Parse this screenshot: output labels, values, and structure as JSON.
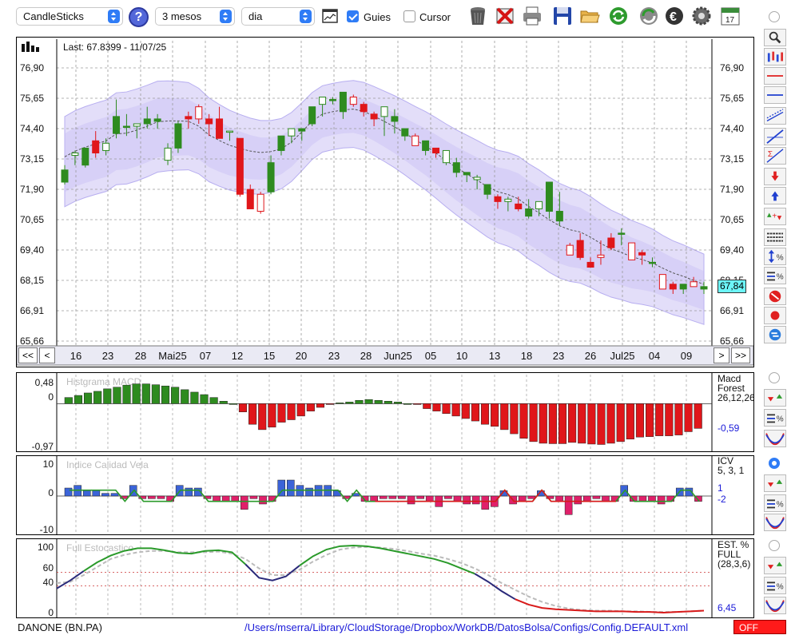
{
  "toolbar": {
    "chart_type": "CandleSticks",
    "help": "?",
    "period": "3 mesos",
    "interval": "dia",
    "guides_label": "Guies",
    "cursor_label": "Cursor"
  },
  "main": {
    "last_label": "Last: 67.8399 - 11/07/25",
    "price_tag": "67,84",
    "nav": {
      "first": "<<",
      "prev": "<",
      "next": ">",
      "last": ">>"
    }
  },
  "status": {
    "symbol": "DANONE (BN.PA)",
    "path": "/Users/mserra/Library/CloudStorage/Dropbox/WorkDB/DatosBolsa/Configs/Config.DEFAULT.xml",
    "off_label": "OFF"
  },
  "colors": {
    "up": "#2e8b1f",
    "down": "#e0161a",
    "band": "#d9d3f7",
    "icv_up": "#3b63d8",
    "icv_down": "#e0206a"
  },
  "chart_data": [
    {
      "type": "candlestick",
      "y_ticks": [
        "76,90",
        "75,65",
        "74,40",
        "73,15",
        "71,90",
        "70,65",
        "69,40",
        "68,15",
        "66,91",
        "65,66"
      ],
      "ylim": [
        65.66,
        76.9
      ],
      "x_labels": [
        "16",
        "23",
        "28",
        "Mai25",
        "07",
        "12",
        "15",
        "20",
        "23",
        "28",
        "Jun25",
        "05",
        "10",
        "13",
        "18",
        "23",
        "26",
        "Jul25",
        "04",
        "09"
      ],
      "candles": [
        [
          72.2,
          72.9,
          72.1,
          72.7
        ],
        [
          73.3,
          73.5,
          72.9,
          73.4
        ],
        [
          72.9,
          73.6,
          72.8,
          73.6
        ],
        [
          73.9,
          74.3,
          73.2,
          73.4
        ],
        [
          73.5,
          74.0,
          73.3,
          73.8
        ],
        [
          74.2,
          75.6,
          74.0,
          74.9
        ],
        [
          74.5,
          75.0,
          74.1,
          74.5
        ],
        [
          74.5,
          74.6,
          74.0,
          74.6
        ],
        [
          74.6,
          75.3,
          74.4,
          74.8
        ],
        [
          74.7,
          75.0,
          74.4,
          74.8
        ],
        [
          73.1,
          73.8,
          72.9,
          73.6
        ],
        [
          73.6,
          74.7,
          73.4,
          74.6
        ],
        [
          74.9,
          75.1,
          74.4,
          74.8
        ],
        [
          75.3,
          75.4,
          74.6,
          74.8
        ],
        [
          74.8,
          75.0,
          74.1,
          74.6
        ],
        [
          74.8,
          75.3,
          74.1,
          74.0
        ],
        [
          74.3,
          74.3,
          73.9,
          74.3
        ],
        [
          74.0,
          74.0,
          71.6,
          71.7
        ],
        [
          71.9,
          72.1,
          71.1,
          71.1
        ],
        [
          71.7,
          71.8,
          70.9,
          71.0
        ],
        [
          71.8,
          73.3,
          71.7,
          73.0
        ],
        [
          73.5,
          74.0,
          73.3,
          74.1
        ],
        [
          74.1,
          74.2,
          73.8,
          74.4
        ],
        [
          74.3,
          74.3,
          73.9,
          74.4
        ],
        [
          74.6,
          75.3,
          74.5,
          75.3
        ],
        [
          75.4,
          75.6,
          74.9,
          75.7
        ],
        [
          75.6,
          75.7,
          75.4,
          75.6
        ],
        [
          75.1,
          75.7,
          74.8,
          75.9
        ],
        [
          75.7,
          75.8,
          75.3,
          75.4
        ],
        [
          75.4,
          75.5,
          74.9,
          75.1
        ],
        [
          75.0,
          75.1,
          74.5,
          74.8
        ],
        [
          74.9,
          75.3,
          74.1,
          75.3
        ],
        [
          74.7,
          75.2,
          74.2,
          74.9
        ],
        [
          74.1,
          74.3,
          73.9,
          74.4
        ],
        [
          74.1,
          74.2,
          73.8,
          73.7
        ],
        [
          73.5,
          73.8,
          73.3,
          73.9
        ],
        [
          73.6,
          73.6,
          73.2,
          73.4
        ],
        [
          73.0,
          73.4,
          72.9,
          73.5
        ],
        [
          72.6,
          73.2,
          72.4,
          73.0
        ],
        [
          72.5,
          72.6,
          72.2,
          72.6
        ],
        [
          72.3,
          72.5,
          71.9,
          72.4
        ],
        [
          71.7,
          72.0,
          71.5,
          72.1
        ],
        [
          71.6,
          71.7,
          71.1,
          71.4
        ],
        [
          71.4,
          71.6,
          71.0,
          71.5
        ],
        [
          71.3,
          71.6,
          71.0,
          71.1
        ],
        [
          70.8,
          71.5,
          70.7,
          71.1
        ],
        [
          71.1,
          71.3,
          70.8,
          71.4
        ],
        [
          71.0,
          71.6,
          70.7,
          72.2
        ],
        [
          70.6,
          71.8,
          70.4,
          71.0
        ],
        [
          69.6,
          69.7,
          69.4,
          69.2
        ],
        [
          69.8,
          70.1,
          69.0,
          69.1
        ],
        [
          68.9,
          69.1,
          68.7,
          68.7
        ],
        [
          69.2,
          69.8,
          68.8,
          69.1
        ],
        [
          69.9,
          70.1,
          69.4,
          69.5
        ],
        [
          70.1,
          70.3,
          69.6,
          70.1
        ],
        [
          69.7,
          69.7,
          69.5,
          69.0
        ],
        [
          69.3,
          69.4,
          68.8,
          69.2
        ],
        [
          68.9,
          69.1,
          68.7,
          68.9
        ],
        [
          68.4,
          68.4,
          68.2,
          67.8
        ],
        [
          68.0,
          68.1,
          67.6,
          67.8
        ],
        [
          67.8,
          68.0,
          67.6,
          68.0
        ],
        [
          68.1,
          68.3,
          67.9,
          67.9
        ],
        [
          67.8,
          68.1,
          67.6,
          67.9
        ]
      ]
    },
    {
      "type": "bar",
      "title": "Histgrama MACD",
      "y_ticks": [
        "0,48",
        "0",
        "-0,97"
      ],
      "right_labels": [
        "Macd",
        "Forest",
        "26,12,26",
        "-0,59"
      ],
      "values": [
        0.15,
        0.2,
        0.26,
        0.3,
        0.36,
        0.4,
        0.45,
        0.48,
        0.48,
        0.46,
        0.43,
        0.4,
        0.34,
        0.28,
        0.22,
        0.15,
        0.06,
        0.0,
        -0.2,
        -0.5,
        -0.63,
        -0.57,
        -0.45,
        -0.39,
        -0.3,
        -0.18,
        -0.09,
        -0.02,
        0.02,
        0.04,
        0.08,
        0.1,
        0.08,
        0.06,
        0.04,
        0.0,
        -0.02,
        -0.12,
        -0.18,
        -0.24,
        -0.3,
        -0.36,
        -0.42,
        -0.5,
        -0.55,
        -0.63,
        -0.73,
        -0.84,
        -0.92,
        -0.96,
        -0.97,
        -0.97,
        -0.94,
        -0.96,
        -0.98,
        -0.99,
        -0.96,
        -0.92,
        -0.86,
        -0.81,
        -0.8,
        -0.78,
        -0.78,
        -0.76,
        -0.68,
        -0.6
      ]
    },
    {
      "type": "bar",
      "title": "Indice Calidad Vela",
      "y_ticks": [
        "10",
        "0",
        "-10"
      ],
      "right_labels": [
        "ICV",
        "5, 3, 1",
        "1",
        "-2"
      ],
      "values": [
        3,
        4,
        2,
        2,
        1,
        1,
        -1,
        4,
        -1,
        -1,
        -1,
        -2,
        4,
        3,
        3,
        -1,
        -2,
        -2,
        -2,
        -5,
        -1,
        -3,
        -2,
        6,
        6,
        4,
        3,
        4,
        4,
        2,
        -1,
        1,
        -2,
        -2,
        -1,
        -1,
        -1,
        -3,
        -1,
        -2,
        -4,
        -1,
        -2,
        -3,
        -3,
        -5,
        -4,
        2,
        -3,
        -2,
        -1,
        2,
        -1,
        -2,
        -7,
        -3,
        -2,
        -1,
        -2,
        -2,
        4,
        -2,
        -2,
        -2,
        -3,
        -2,
        3,
        3,
        -2
      ]
    },
    {
      "type": "line",
      "title": "Full Estocastico",
      "y_ticks": [
        "100",
        "60",
        "40",
        "0"
      ],
      "right_labels": [
        "EST. %",
        "FULL",
        "(28,3,6)",
        "6,45"
      ],
      "ylim": [
        0,
        100
      ]
    }
  ]
}
